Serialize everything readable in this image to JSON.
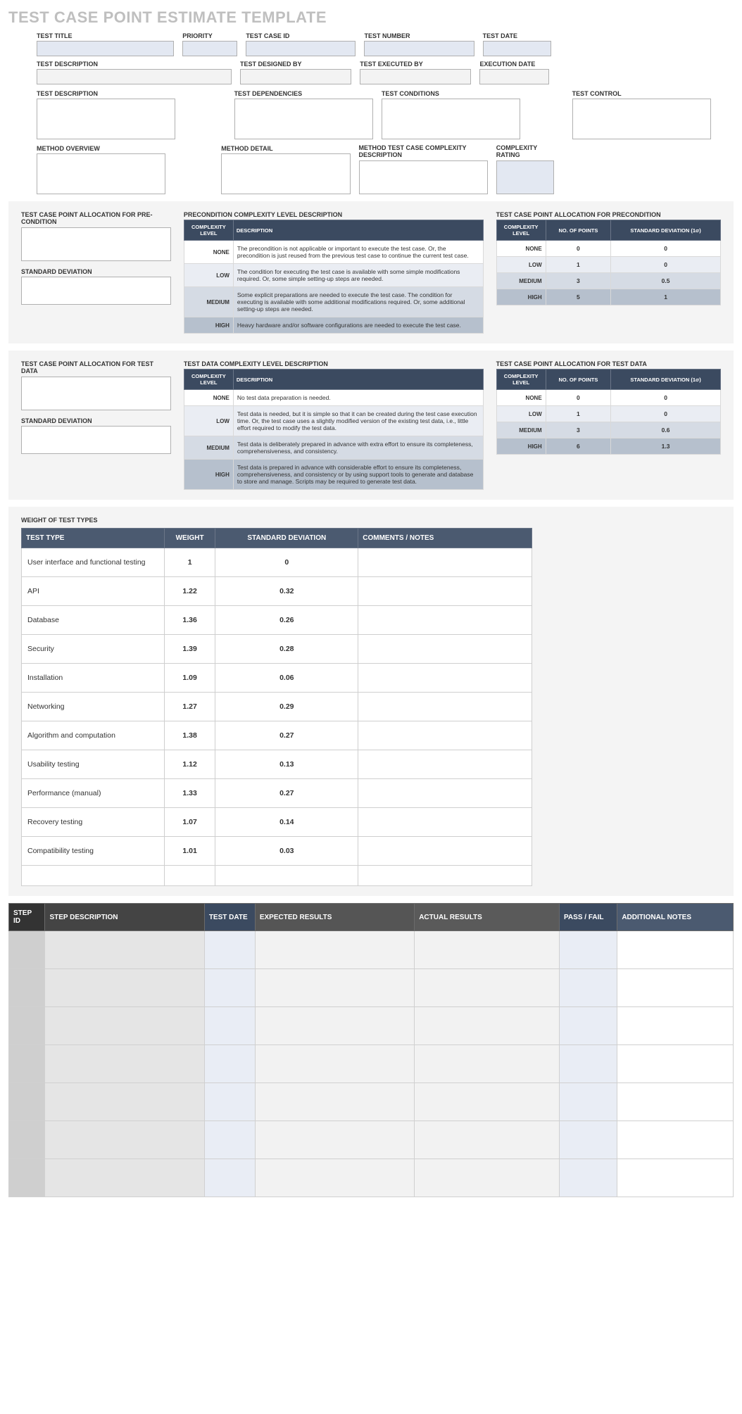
{
  "title": "TEST CASE POINT ESTIMATE TEMPLATE",
  "hdr": {
    "test_title": "TEST TITLE",
    "priority": "PRIORITY",
    "test_case_id": "TEST CASE ID",
    "test_number": "TEST NUMBER",
    "test_date": "TEST DATE",
    "test_description": "TEST DESCRIPTION",
    "test_designed_by": "TEST DESIGNED BY",
    "test_executed_by": "TEST EXECUTED BY",
    "execution_date": "EXECUTION DATE",
    "test_dependencies": "TEST DEPENDENCIES",
    "test_conditions": "TEST CONDITIONS",
    "test_control": "TEST CONTROL",
    "method_overview": "METHOD OVERVIEW",
    "method_detail": "METHOD DETAIL",
    "method_complexity_desc": "METHOD TEST CASE COMPLEXITY DESCRIPTION",
    "complexity_rating": "COMPLEXITY RATING"
  },
  "pre": {
    "alloc_title": "TEST CASE POINT ALLOCATION FOR PRE-CONDITION",
    "sd_title": "STANDARD DEVIATION",
    "desc_title": "PRECONDITION COMPLEXITY LEVEL DESCRIPTION",
    "alloc2_title": "TEST CASE POINT ALLOCATION FOR PRECONDITION",
    "cols_desc": {
      "c1": "COMPLEXITY LEVEL",
      "c2": "DESCRIPTION"
    },
    "cols_alloc": {
      "c1": "COMPLEXITY LEVEL",
      "c2": "NO. OF POINTS",
      "c3": "STANDARD DEVIATION (1σ)"
    },
    "rows": [
      {
        "level": "NONE",
        "desc": "The precondition is not applicable or important to execute the test case. Or, the precondition is just reused from the previous test case to continue the current test case.",
        "pts": "0",
        "sd": "0"
      },
      {
        "level": "LOW",
        "desc": "The condition for executing the test case is available with some simple modifications required. Or, some simple setting-up steps are needed.",
        "pts": "1",
        "sd": "0"
      },
      {
        "level": "MEDIUM",
        "desc": "Some explicit preparations are needed to execute the test case. The condition for executing is available with some additional modifications required. Or, some additional setting-up steps are needed.",
        "pts": "3",
        "sd": "0.5"
      },
      {
        "level": "HIGH",
        "desc": "Heavy hardware and/or software configurations are needed to execute the test case.",
        "pts": "5",
        "sd": "1"
      }
    ]
  },
  "td": {
    "alloc_title": "TEST CASE POINT ALLOCATION FOR TEST DATA",
    "sd_title": "STANDARD DEVIATION",
    "desc_title": "TEST DATA COMPLEXITY LEVEL DESCRIPTION",
    "alloc2_title": "TEST CASE POINT ALLOCATION FOR TEST DATA",
    "cols_desc": {
      "c1": "COMPLEXITY LEVEL",
      "c2": "DESCRIPTION"
    },
    "cols_alloc": {
      "c1": "COMPLEXITY LEVEL",
      "c2": "NO. OF POINTS",
      "c3": "STANDARD DEVIATION (1σ)"
    },
    "rows": [
      {
        "level": "NONE",
        "desc": "No test data preparation is needed.",
        "pts": "0",
        "sd": "0"
      },
      {
        "level": "LOW",
        "desc": "Test data is needed, but it is simple so that it can be created during the test case execution time. Or, the test case uses a slightly modified version of the existing test data, i.e., little effort required to modify the test data.",
        "pts": "1",
        "sd": "0"
      },
      {
        "level": "MEDIUM",
        "desc": "Test data is deliberately prepared in advance with extra effort to ensure its completeness, comprehensiveness, and consistency.",
        "pts": "3",
        "sd": "0.6"
      },
      {
        "level": "HIGH",
        "desc": "Test data is prepared in advance with considerable effort to ensure its completeness, comprehensiveness, and consistency or by using support tools to generate and database to store and manage. Scripts may be required to generate test data.",
        "pts": "6",
        "sd": "1.3"
      }
    ]
  },
  "weights": {
    "title": "WEIGHT OF TEST TYPES",
    "cols": {
      "c1": "TEST TYPE",
      "c2": "WEIGHT",
      "c3": "STANDARD DEVIATION",
      "c4": "COMMENTS / NOTES"
    },
    "rows": [
      {
        "t": "User interface and functional testing",
        "w": "1",
        "sd": "0",
        "n": ""
      },
      {
        "t": "API",
        "w": "1.22",
        "sd": "0.32",
        "n": ""
      },
      {
        "t": "Database",
        "w": "1.36",
        "sd": "0.26",
        "n": ""
      },
      {
        "t": "Security",
        "w": "1.39",
        "sd": "0.28",
        "n": ""
      },
      {
        "t": "Installation",
        "w": "1.09",
        "sd": "0.06",
        "n": ""
      },
      {
        "t": "Networking",
        "w": "1.27",
        "sd": "0.29",
        "n": ""
      },
      {
        "t": "Algorithm and computation",
        "w": "1.38",
        "sd": "0.27",
        "n": ""
      },
      {
        "t": "Usability testing",
        "w": "1.12",
        "sd": "0.13",
        "n": ""
      },
      {
        "t": "Performance (manual)",
        "w": "1.33",
        "sd": "0.27",
        "n": ""
      },
      {
        "t": "Recovery testing",
        "w": "1.07",
        "sd": "0.14",
        "n": ""
      },
      {
        "t": "Compatibility testing",
        "w": "1.01",
        "sd": "0.03",
        "n": ""
      },
      {
        "t": "",
        "w": "",
        "sd": "",
        "n": ""
      }
    ]
  },
  "steps": {
    "cols": {
      "c1": "STEP ID",
      "c2": "STEP DESCRIPTION",
      "c3": "TEST DATE",
      "c4": "EXPECTED RESULTS",
      "c5": "ACTUAL RESULTS",
      "c6": "PASS / FAIL",
      "c7": "ADDITIONAL NOTES"
    },
    "row_count": 7
  }
}
